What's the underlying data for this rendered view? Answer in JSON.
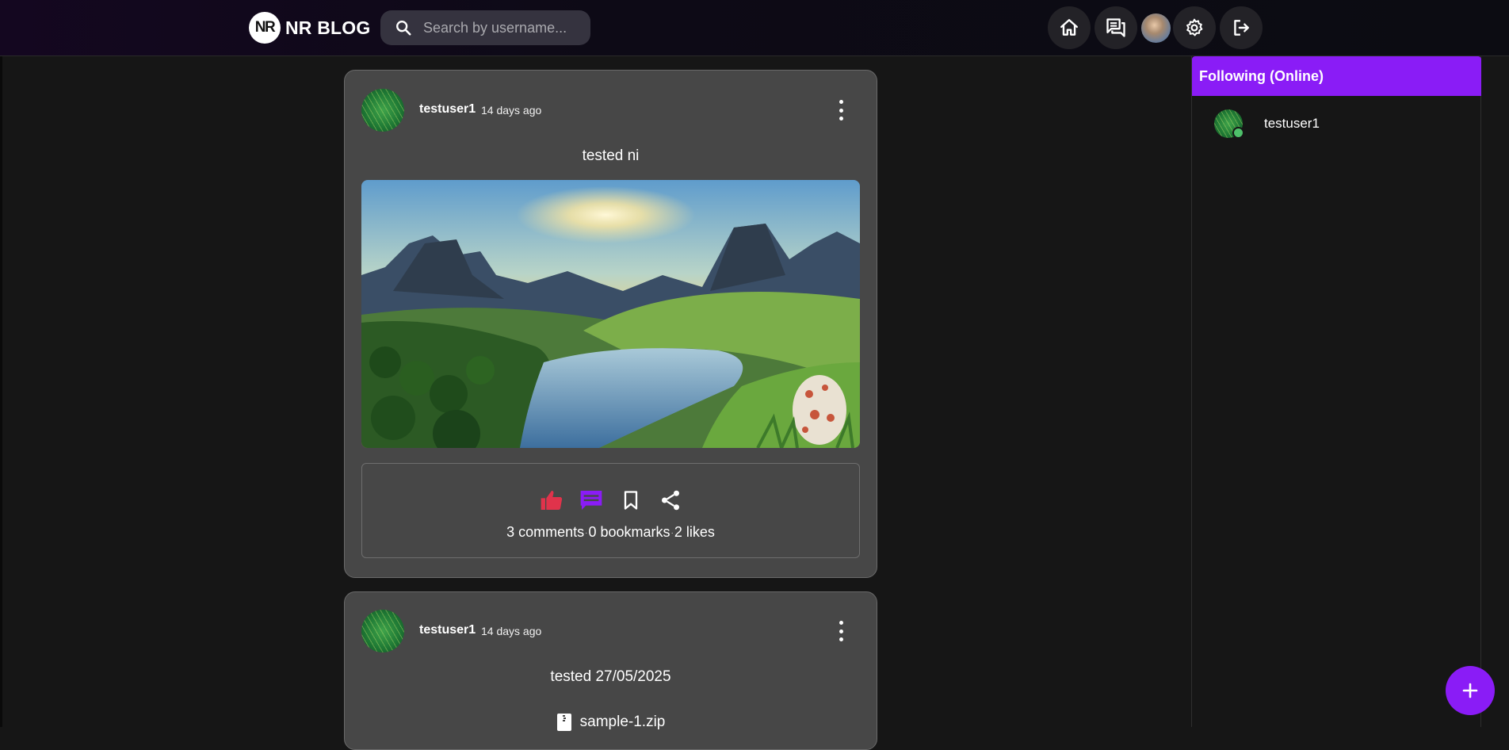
{
  "header": {
    "logo_badge": "NR",
    "logo_text": "NR BLOG",
    "search_placeholder": "Search by username...",
    "nav_icons": [
      "home-icon",
      "chat-icon",
      "avatar",
      "gear-icon",
      "logout-icon"
    ]
  },
  "posts": [
    {
      "username": "testuser1",
      "time": "14 days ago",
      "text": "tested ni",
      "image": "landscape-painting",
      "stats": {
        "comments": "3 comments",
        "bookmarks": "0 bookmarks",
        "likes": "2 likes",
        "separator": "·"
      }
    },
    {
      "username": "testuser1",
      "time": "14 days ago",
      "text": "tested 27/05/2025",
      "attachment": "sample-1.zip"
    }
  ],
  "sidebar": {
    "title": "Following (Online)",
    "items": [
      {
        "name": "testuser1",
        "status": "online"
      }
    ]
  },
  "colors": {
    "accent": "#8a1cf6",
    "like": "#e0334b",
    "comment": "#8a1cf6",
    "online": "#4ec06a"
  }
}
